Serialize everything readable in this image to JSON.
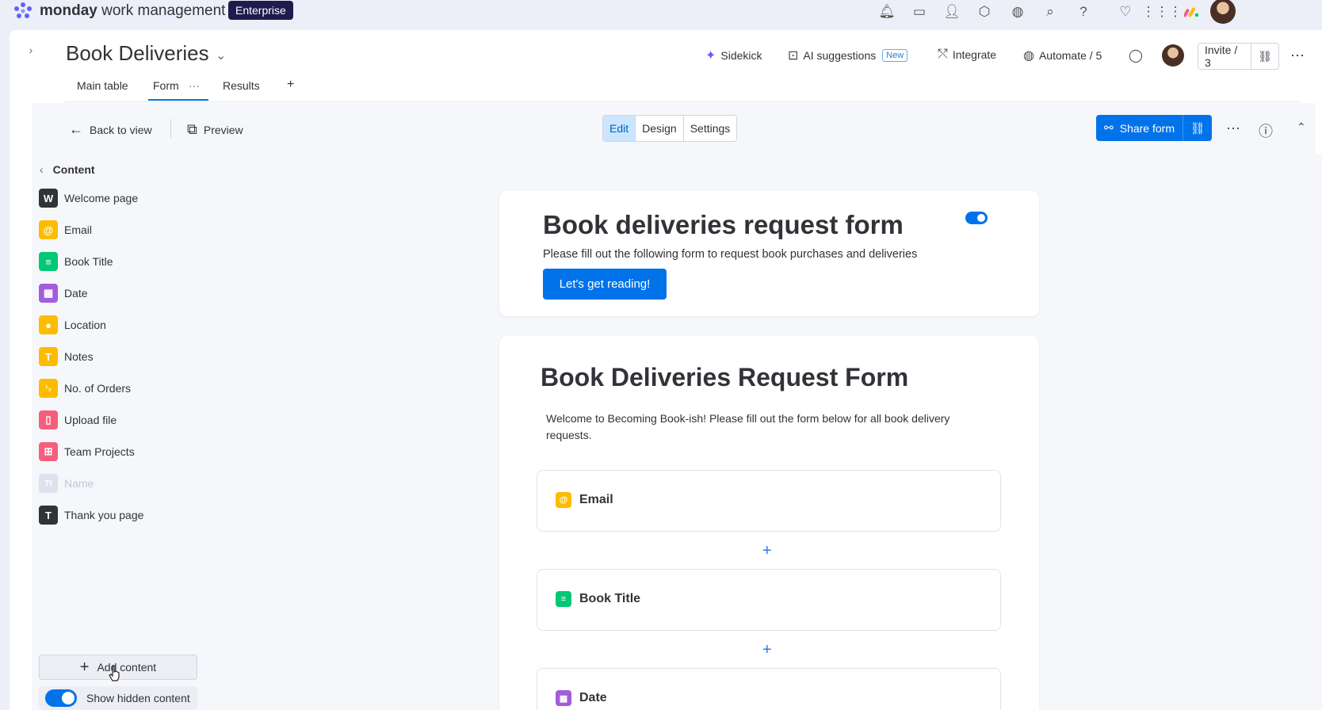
{
  "topbar": {
    "brand_bold": "monday",
    "brand_rest": "work management",
    "plan_badge": "Enterprise"
  },
  "board": {
    "title": "Book Deliveries",
    "tabs": [
      {
        "label": "Main table"
      },
      {
        "label": "Form",
        "active": true,
        "more": "···"
      },
      {
        "label": "Results"
      }
    ],
    "add_tab": "+"
  },
  "header_actions": {
    "sidekick": "Sidekick",
    "ai_suggestions": "AI suggestions",
    "ai_badge": "New",
    "integrate": "Integrate",
    "automate": "Automate / 5",
    "invite": "Invite / 3"
  },
  "form_toolbar": {
    "back": "Back to view",
    "preview": "Preview",
    "modes": [
      "Edit",
      "Design",
      "Settings"
    ],
    "active_mode": "Edit",
    "share": "Share form"
  },
  "content_panel": {
    "header": "Content",
    "items": [
      {
        "label": "Welcome page",
        "icon": "W",
        "color": "#323338"
      },
      {
        "label": "Email",
        "icon": "@",
        "color": "#fdbc00"
      },
      {
        "label": "Book Title",
        "icon": "≡",
        "color": "#00c875"
      },
      {
        "label": "Date",
        "icon": "▦",
        "color": "#a25ddc"
      },
      {
        "label": "Location",
        "icon": "●",
        "color": "#fdbc00"
      },
      {
        "label": "Notes",
        "icon": "T",
        "color": "#fdbc00"
      },
      {
        "label": "No. of Orders",
        "icon": "¹₂",
        "color": "#fdbc00"
      },
      {
        "label": "Upload file",
        "icon": "▯",
        "color": "#f65f7c"
      },
      {
        "label": "Team Projects",
        "icon": "⊞",
        "color": "#f65f7c"
      },
      {
        "label": "Name",
        "icon": "Tt",
        "color": "#dfe2ee",
        "hidden": true
      },
      {
        "label": "Thank you page",
        "icon": "T",
        "color": "#323338"
      }
    ],
    "add_content": "Add content",
    "show_hidden": "Show hidden content"
  },
  "welcome_card": {
    "title": "Book deliveries request form",
    "subtitle": "Please fill out the following form to request book purchases and deliveries",
    "cta": "Let's get reading!"
  },
  "form_card": {
    "title": "Book Deliveries Request Form",
    "description": "Welcome to Becoming Book-ish! Please fill out the form below for all book delivery requests.",
    "questions": [
      {
        "label": "Email",
        "icon": "@",
        "color": "#fdbc00"
      },
      {
        "label": "Book Title",
        "icon": "≡",
        "color": "#00c875"
      },
      {
        "label": "Date",
        "icon": "▦",
        "color": "#a25ddc"
      }
    ],
    "add_question": "+"
  },
  "colors": {
    "accent": "#0073ea",
    "brand_dark": "#1f1c4d"
  }
}
